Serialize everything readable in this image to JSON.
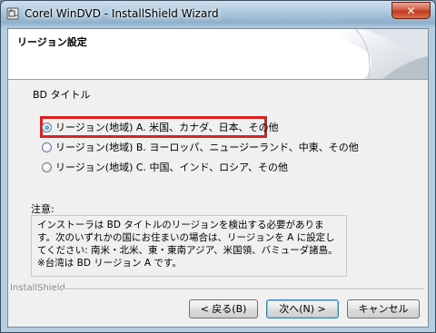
{
  "window": {
    "title": "Corel WinDVD - InstallShield Wizard",
    "close_label": "✕"
  },
  "header": {
    "title": "リージョン設定"
  },
  "section_label": "BD タイトル",
  "options": [
    {
      "label": "リージョン(地域) A. 米国、カナダ、日本、その他",
      "checked": true
    },
    {
      "label": "リージョン(地域) B. ヨーロッパ、ニュージーランド、中東、その他",
      "checked": false
    },
    {
      "label": "リージョン(地域) C. 中国、インド、ロシア、その他",
      "checked": false
    }
  ],
  "note": {
    "label": "注意:",
    "text": "インストーラは BD タイトルのリージョンを検出する必要があります。次のいずれかの国にお住まいの場合は、リージョンを A に設定してください: 南米・北米、東・東南アジア、米国領、バミューダ諸島。※台湾は BD リージョン A です。"
  },
  "footer": {
    "brand": "InstallShield"
  },
  "buttons": {
    "back": "< 戻る(B)",
    "next": "次へ(N) >",
    "cancel": "キャンセル"
  },
  "colors": {
    "highlight": "#e02020",
    "close": "#c03a1c"
  }
}
